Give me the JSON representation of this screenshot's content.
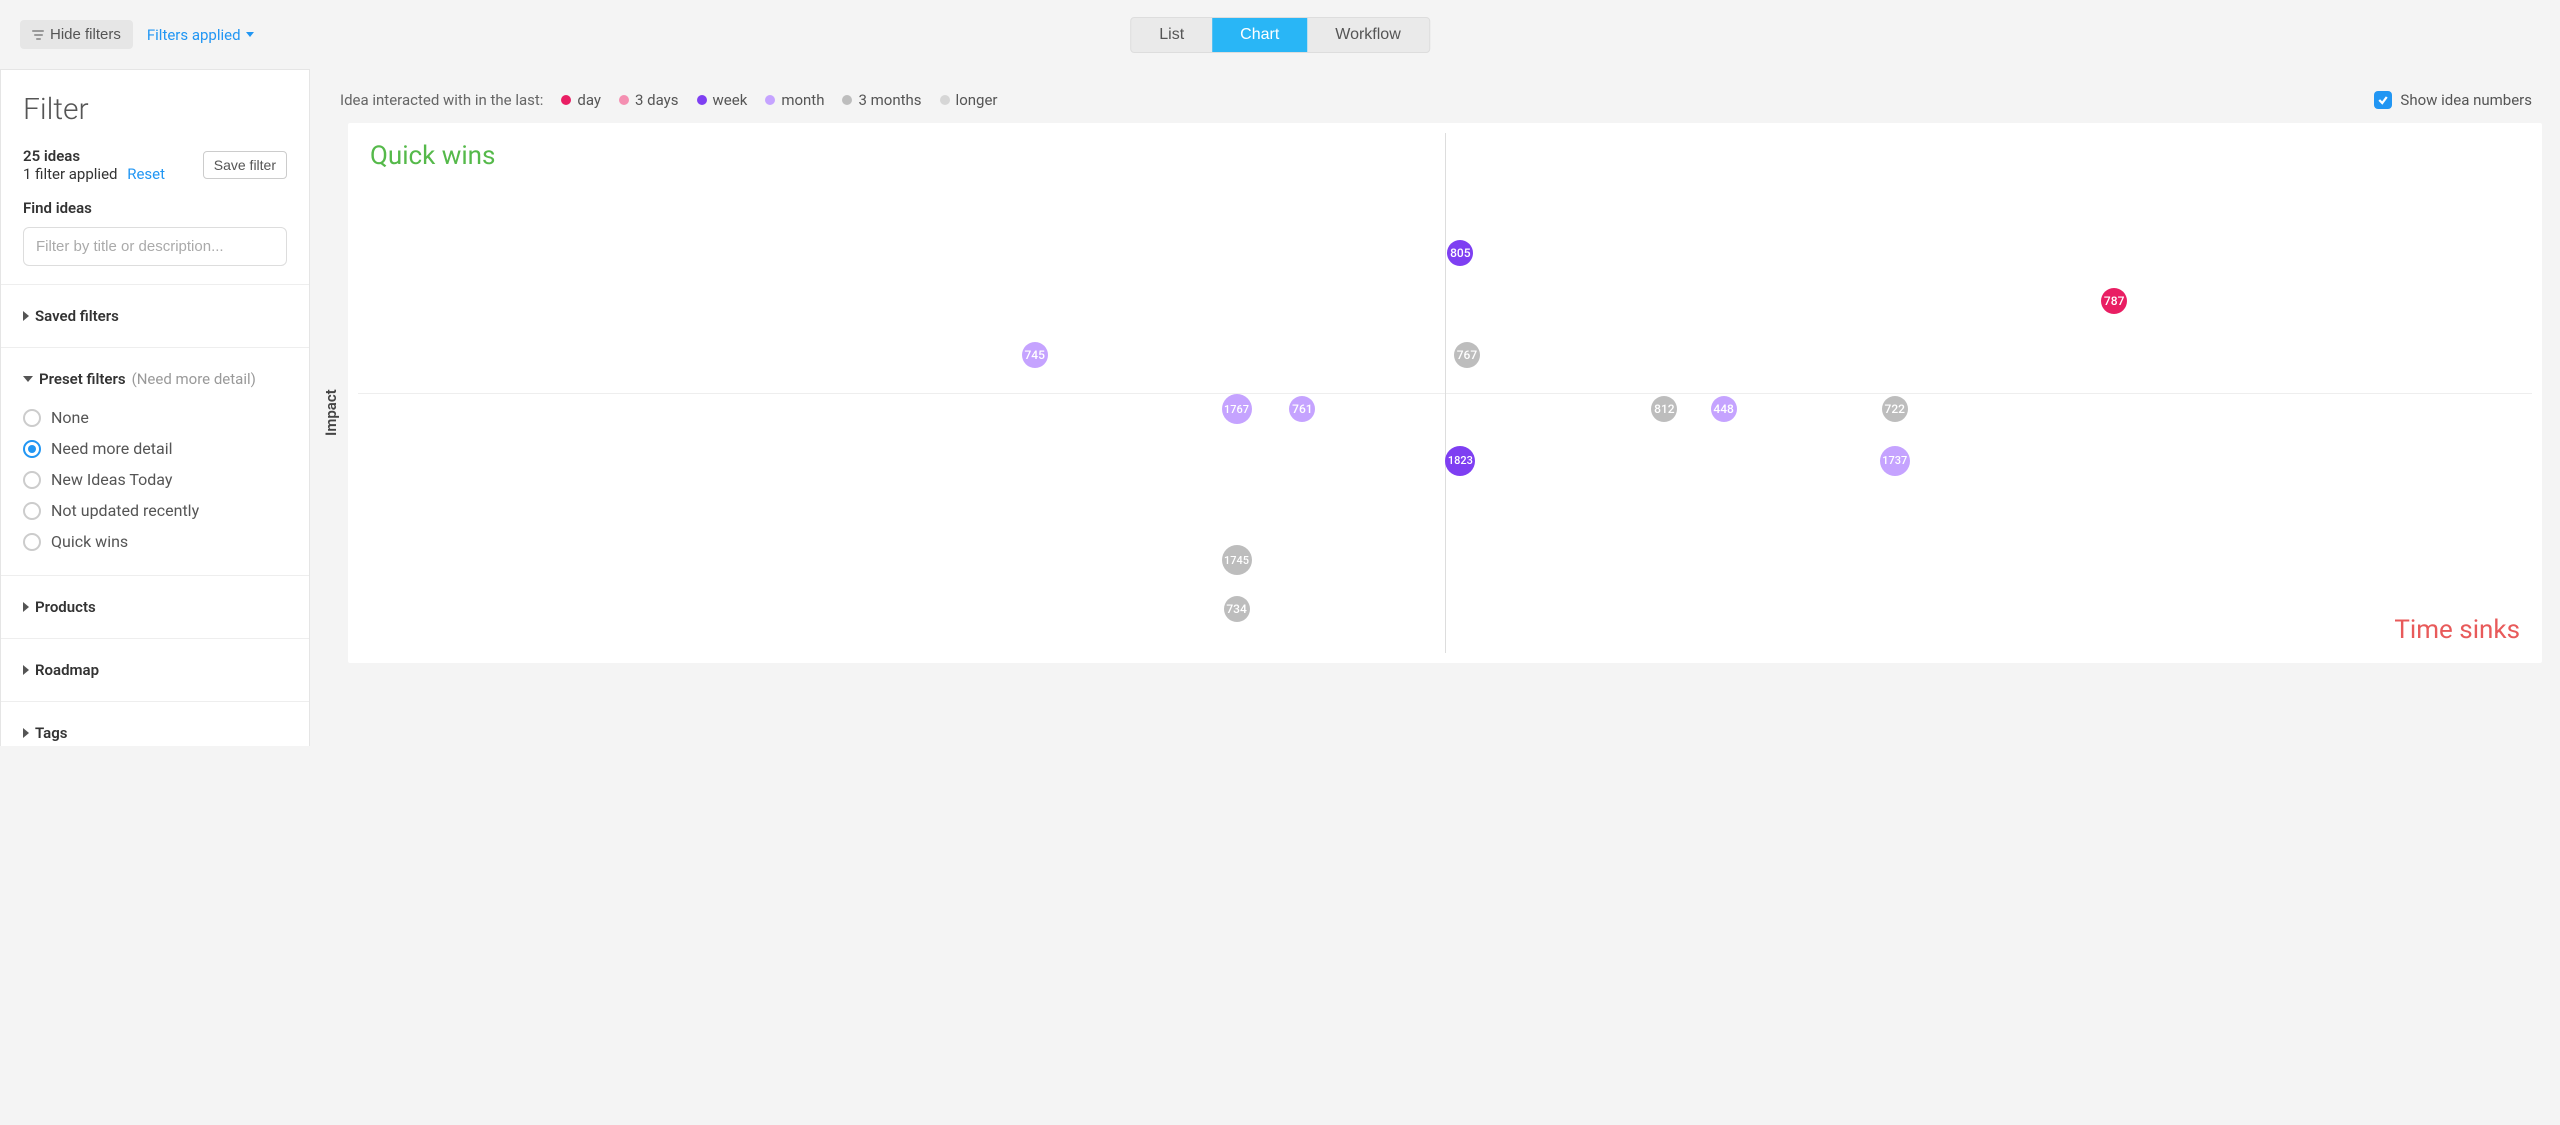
{
  "topbar": {
    "hide_filters": "Hide filters",
    "filters_applied": "Filters applied",
    "tabs": {
      "list": "List",
      "chart": "Chart",
      "workflow": "Workflow",
      "active": "chart"
    }
  },
  "sidebar": {
    "title": "Filter",
    "ideas_count": "25 ideas",
    "applied_line": "1 filter applied",
    "reset": "Reset",
    "save_filter": "Save filter",
    "find_ideas_label": "Find ideas",
    "search_placeholder": "Filter by title or description...",
    "saved_filters": "Saved filters",
    "preset_filters_label": "Preset filters",
    "preset_filters_sub": "(Need more detail)",
    "preset_options": [
      "None",
      "Need more detail",
      "New Ideas Today",
      "Not updated recently",
      "Quick wins"
    ],
    "preset_selected": 1,
    "products": "Products",
    "roadmap": "Roadmap",
    "tags": "Tags"
  },
  "legend": {
    "prefix": "Idea interacted with in the last:",
    "items": [
      {
        "label": "day",
        "color": "#e91e63"
      },
      {
        "label": "3 days",
        "color": "#f48fb1"
      },
      {
        "label": "week",
        "color": "#7e3ff2"
      },
      {
        "label": "month",
        "color": "#c5a3ff"
      },
      {
        "label": "3 months",
        "color": "#bdbdbd"
      },
      {
        "label": "longer",
        "color": "#d6d6d6"
      }
    ],
    "show_idea_numbers_label": "Show idea numbers",
    "show_idea_numbers_checked": true
  },
  "chart_data": {
    "type": "scatter",
    "title": "",
    "xlabel": "",
    "ylabel": "Impact",
    "x_range_pct": [
      0,
      100
    ],
    "y_range_pct": [
      0,
      100
    ],
    "quadrant_labels": {
      "top_left": "Quick wins",
      "bottom_right": "Time sinks"
    },
    "points": [
      {
        "id": "805",
        "x_pct": 50.7,
        "y_pct": 76,
        "group": "week"
      },
      {
        "id": "787",
        "x_pct": 80.5,
        "y_pct": 67,
        "group": "day"
      },
      {
        "id": "745",
        "x_pct": 31.3,
        "y_pct": 57,
        "group": "month"
      },
      {
        "id": "767",
        "x_pct": 51,
        "y_pct": 57,
        "group": "3 months"
      },
      {
        "id": "1767",
        "x_pct": 40.5,
        "y_pct": 47,
        "group": "month"
      },
      {
        "id": "761",
        "x_pct": 43.5,
        "y_pct": 47,
        "group": "month"
      },
      {
        "id": "812",
        "x_pct": 60,
        "y_pct": 47,
        "group": "3 months"
      },
      {
        "id": "448",
        "x_pct": 62.7,
        "y_pct": 47,
        "group": "month"
      },
      {
        "id": "722",
        "x_pct": 70.5,
        "y_pct": 47,
        "group": "3 months"
      },
      {
        "id": "1823",
        "x_pct": 50.7,
        "y_pct": 37.5,
        "group": "week"
      },
      {
        "id": "1737",
        "x_pct": 70.5,
        "y_pct": 37.5,
        "group": "month"
      },
      {
        "id": "1745",
        "x_pct": 40.5,
        "y_pct": 19,
        "group": "3 months"
      },
      {
        "id": "734",
        "x_pct": 40.5,
        "y_pct": 10,
        "group": "3 months"
      }
    ]
  },
  "colors": {
    "day": "#e91e63",
    "3 days": "#f48fb1",
    "week": "#7e3ff2",
    "month": "#c5a3ff",
    "3 months": "#bdbdbd",
    "longer": "#d6d6d6"
  }
}
